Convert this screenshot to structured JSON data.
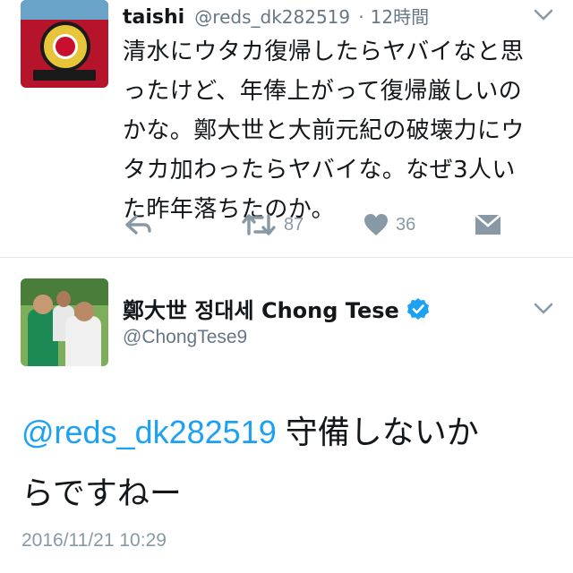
{
  "tweet1": {
    "display_name": "taishi",
    "handle": "@reds_dk282519",
    "separator": "·",
    "time": "12時間",
    "text_lines": [
      "清水にウタカ復帰したらヤバイなと思",
      "ったけど、年俸上がって復帰厳しいの",
      "かな。鄭大世と大前元紀の破壊力にウ",
      "タカ加わったらヤバイな。なぜ3人い",
      "た昨年落ちたのか。"
    ],
    "retweet_count": "87",
    "like_count": "36",
    "icons": {
      "reply": "reply-icon",
      "retweet": "retweet-icon",
      "like": "heart-icon",
      "dm": "envelope-icon",
      "more": "chevron-down-icon"
    }
  },
  "tweet2": {
    "display_name": "鄭大世 정대세 Chong Tese",
    "handle": "@ChongTese9",
    "mention": "@reds_dk282519",
    "text_after_mention": " 守備しないか",
    "text_line2": "らですねー",
    "timestamp": "2016/11/21 10:29",
    "verified": true,
    "icons": {
      "verified": "verified-badge-icon",
      "more": "chevron-down-icon"
    }
  },
  "colors": {
    "link": "#1da1f2",
    "secondary_text": "#657786",
    "action_gray": "#8899a6",
    "divider": "#e1e8ed"
  }
}
